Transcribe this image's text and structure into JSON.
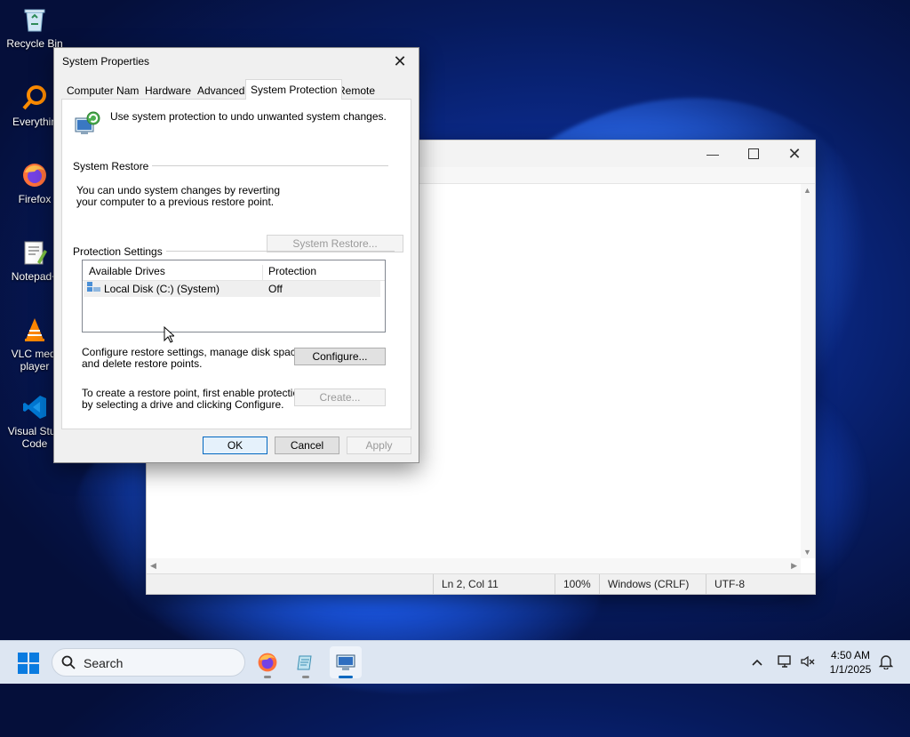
{
  "desktop": {
    "icons": [
      {
        "label": "Recycle Bin"
      },
      {
        "label": "Everythin"
      },
      {
        "label": "Firefox"
      },
      {
        "label": "Notepad+"
      },
      {
        "label": "VLC medi\nplayer"
      },
      {
        "label": "Visual Stud\nCode"
      }
    ]
  },
  "notepad": {
    "status": {
      "position": "Ln 2, Col 11",
      "zoom": "100%",
      "line_ending": "Windows (CRLF)",
      "encoding": "UTF-8"
    }
  },
  "dialog": {
    "title": "System Properties",
    "tabs": [
      "Computer Name",
      "Hardware",
      "Advanced",
      "System Protection",
      "Remote"
    ],
    "active_tab": "System Protection",
    "intro": "Use system protection to undo unwanted system changes.",
    "system_restore": {
      "group_label": "System Restore",
      "text_line1": "You can undo system changes by reverting",
      "text_line2": "your computer to a previous restore point.",
      "button": "System Restore..."
    },
    "protection": {
      "group_label": "Protection Settings",
      "columns": [
        "Available Drives",
        "Protection"
      ],
      "rows": [
        {
          "drive": "Local Disk (C:) (System)",
          "protection": "Off"
        }
      ],
      "configure_text_line1": "Configure restore settings, manage disk space,",
      "configure_text_line2": "and delete restore points.",
      "configure_button": "Configure...",
      "create_text_line1": "To create a restore point, first enable protection",
      "create_text_line2": "by selecting a drive and clicking Configure.",
      "create_button": "Create..."
    },
    "footer": {
      "ok": "OK",
      "cancel": "Cancel",
      "apply": "Apply"
    }
  },
  "taskbar": {
    "search_placeholder": "Search",
    "apps": [
      {
        "icon": "firefox-icon"
      },
      {
        "icon": "notepad-icon"
      },
      {
        "icon": "system-properties-icon"
      }
    ],
    "time": "4:50 AM",
    "date": "1/1/2025"
  }
}
